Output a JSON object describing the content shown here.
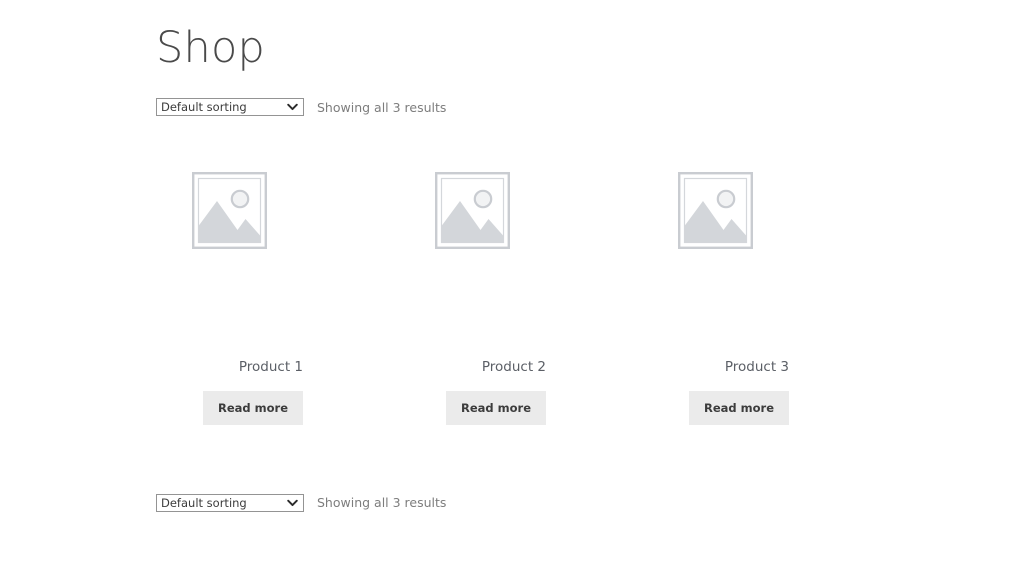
{
  "page": {
    "title": "Shop"
  },
  "toolbar_top": {
    "ordering_value": "Default sorting",
    "ordering_options": [
      "Default sorting"
    ],
    "result_count": "Showing all 3 results",
    "chevron_icon": "chevron-down-icon"
  },
  "toolbar_bottom": {
    "ordering_value": "Default sorting",
    "ordering_options": [
      "Default sorting"
    ],
    "result_count": "Showing all 3 results",
    "chevron_icon": "chevron-down-icon"
  },
  "products": [
    {
      "title": "Product 1",
      "button_label": "Read more",
      "thumbnail_icon": "image-placeholder-icon"
    },
    {
      "title": "Product 2",
      "button_label": "Read more",
      "thumbnail_icon": "image-placeholder-icon"
    },
    {
      "title": "Product 3",
      "button_label": "Read more",
      "thumbnail_icon": "image-placeholder-icon"
    }
  ],
  "colors": {
    "background": "#ffffff",
    "heading": "#4a4a4a",
    "body_text": "#43454b",
    "muted_text": "#7d7d7d",
    "button_bg": "#ebebeb",
    "placeholder_stroke": "#c9ccd1",
    "select_border": "#949494"
  }
}
